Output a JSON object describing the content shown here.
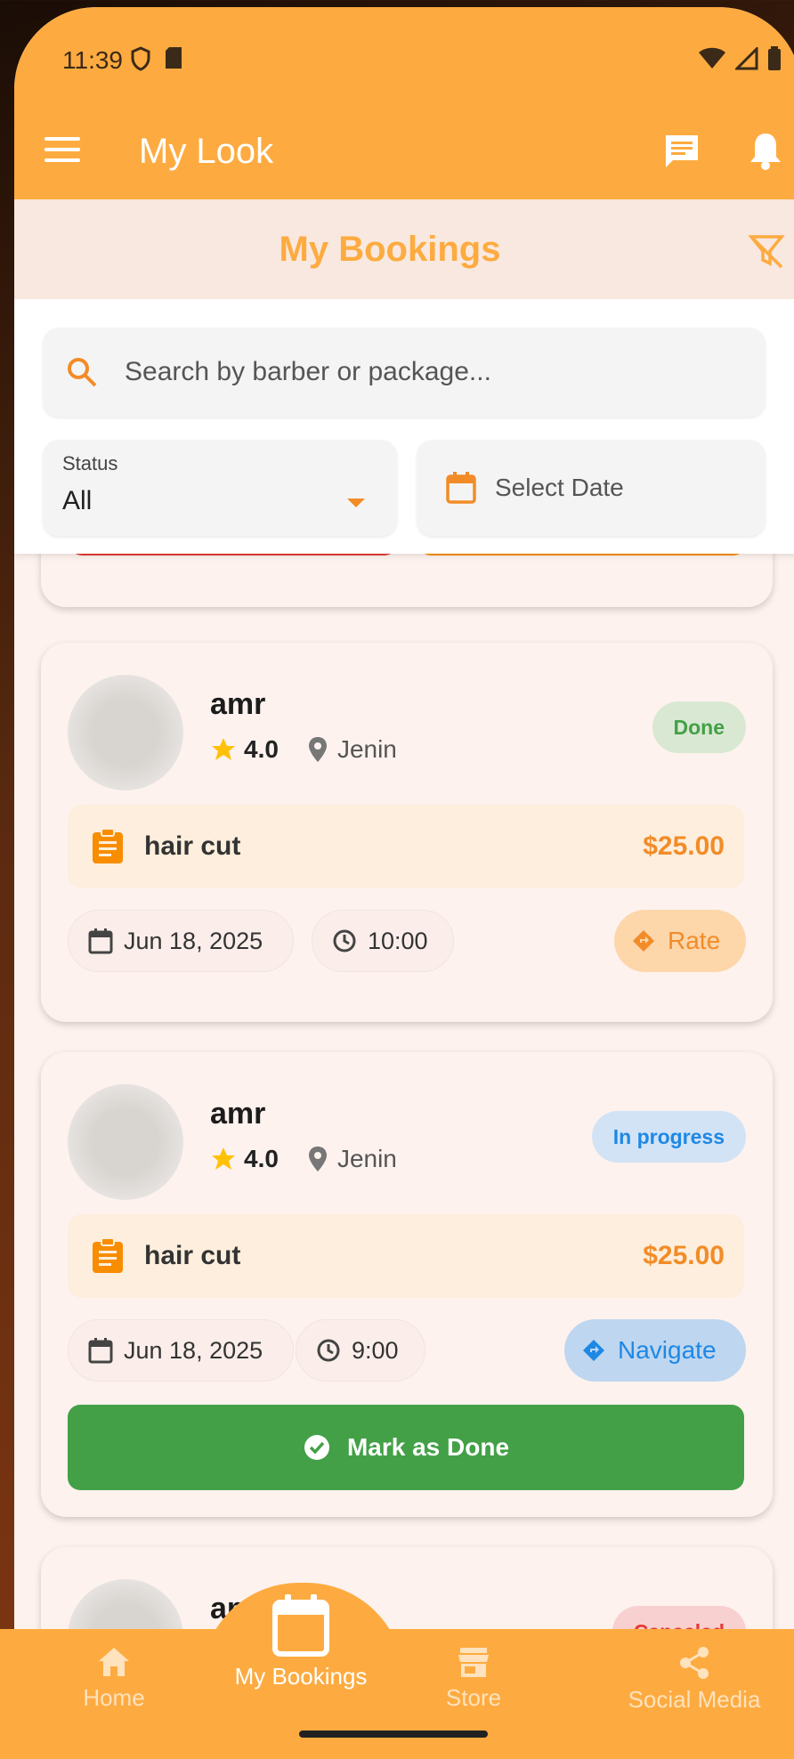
{
  "status_bar": {
    "time": "11:39"
  },
  "app_bar": {
    "title": "My Look"
  },
  "page": {
    "title": "My Bookings"
  },
  "filters": {
    "search_placeholder": "Search by barber or package...",
    "status_label": "Status",
    "status_value": "All",
    "date_label": "Select Date"
  },
  "bookings": [
    {
      "barber": "amr",
      "rating": "4.0",
      "location": "Jenin",
      "status": "Done",
      "package": "hair cut",
      "price": "$25.00",
      "date": "Jun 18, 2025",
      "time": "10:00",
      "action": "Rate"
    },
    {
      "barber": "amr",
      "rating": "4.0",
      "location": "Jenin",
      "status": "In progress",
      "package": "hair cut",
      "price": "$25.00",
      "date": "Jun 18, 2025",
      "time": "9:00",
      "action": "Navigate",
      "primary_action": "Mark as Done"
    },
    {
      "barber": "amr",
      "status": "Canceled"
    }
  ],
  "bottom_nav": {
    "home": "Home",
    "bookings": "My Bookings",
    "store": "Store",
    "social": "Social Media"
  },
  "colors": {
    "primary": "#FDAB40",
    "done": "#43A047",
    "in_progress": "#1E88E5",
    "canceled": "#E53935"
  }
}
